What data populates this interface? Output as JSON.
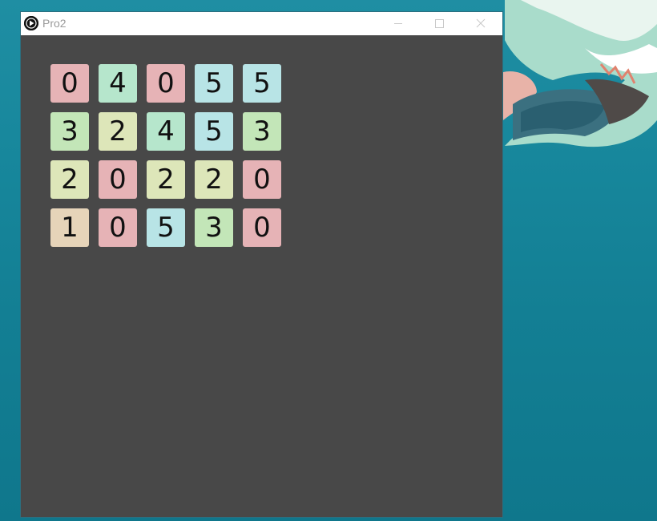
{
  "window": {
    "title": "Pro2"
  },
  "colors": {
    "0": "#e6b3b6",
    "1": "#e6d4b9",
    "2": "#dde6b9",
    "3": "#c3e6b8",
    "4": "#b6e6cc",
    "5": "#b8e4e6"
  },
  "grid": [
    [
      "0",
      "4",
      "0",
      "5",
      "5"
    ],
    [
      "3",
      "2",
      "4",
      "5",
      "3"
    ],
    [
      "2",
      "0",
      "2",
      "2",
      "0"
    ],
    [
      "1",
      "0",
      "5",
      "3",
      "0"
    ]
  ],
  "icons": {
    "app": "app-icon",
    "minimize": "minimize-icon",
    "maximize": "maximize-icon",
    "close": "close-icon"
  }
}
